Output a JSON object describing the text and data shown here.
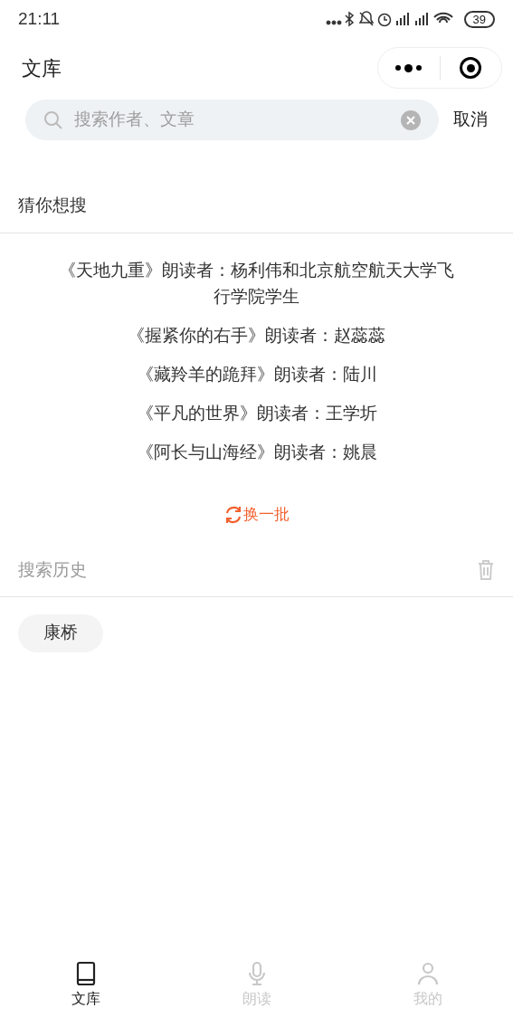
{
  "status_bar": {
    "time": "21:11",
    "battery": "39"
  },
  "header": {
    "title": "文库"
  },
  "search": {
    "placeholder": "搜索作者、文章",
    "cancel": "取消"
  },
  "suggestions": {
    "title": "猜你想搜",
    "items": [
      "《天地九重》朗读者：杨利伟和北京航空航天大学飞行学院学生",
      "《握紧你的右手》朗读者：赵蕊蕊",
      "《藏羚羊的跪拜》朗读者：陆川",
      "《平凡的世界》朗读者：王学圻",
      "《阿长与山海经》朗读者：姚晨"
    ],
    "refresh": "换一批"
  },
  "history": {
    "title": "搜索历史",
    "items": [
      "康桥"
    ]
  },
  "tab_bar": [
    {
      "kind": "book",
      "label": "文库",
      "selected": true
    },
    {
      "kind": "mic",
      "label": "朗读",
      "selected": false
    },
    {
      "kind": "person",
      "label": "我的",
      "selected": false
    }
  ]
}
